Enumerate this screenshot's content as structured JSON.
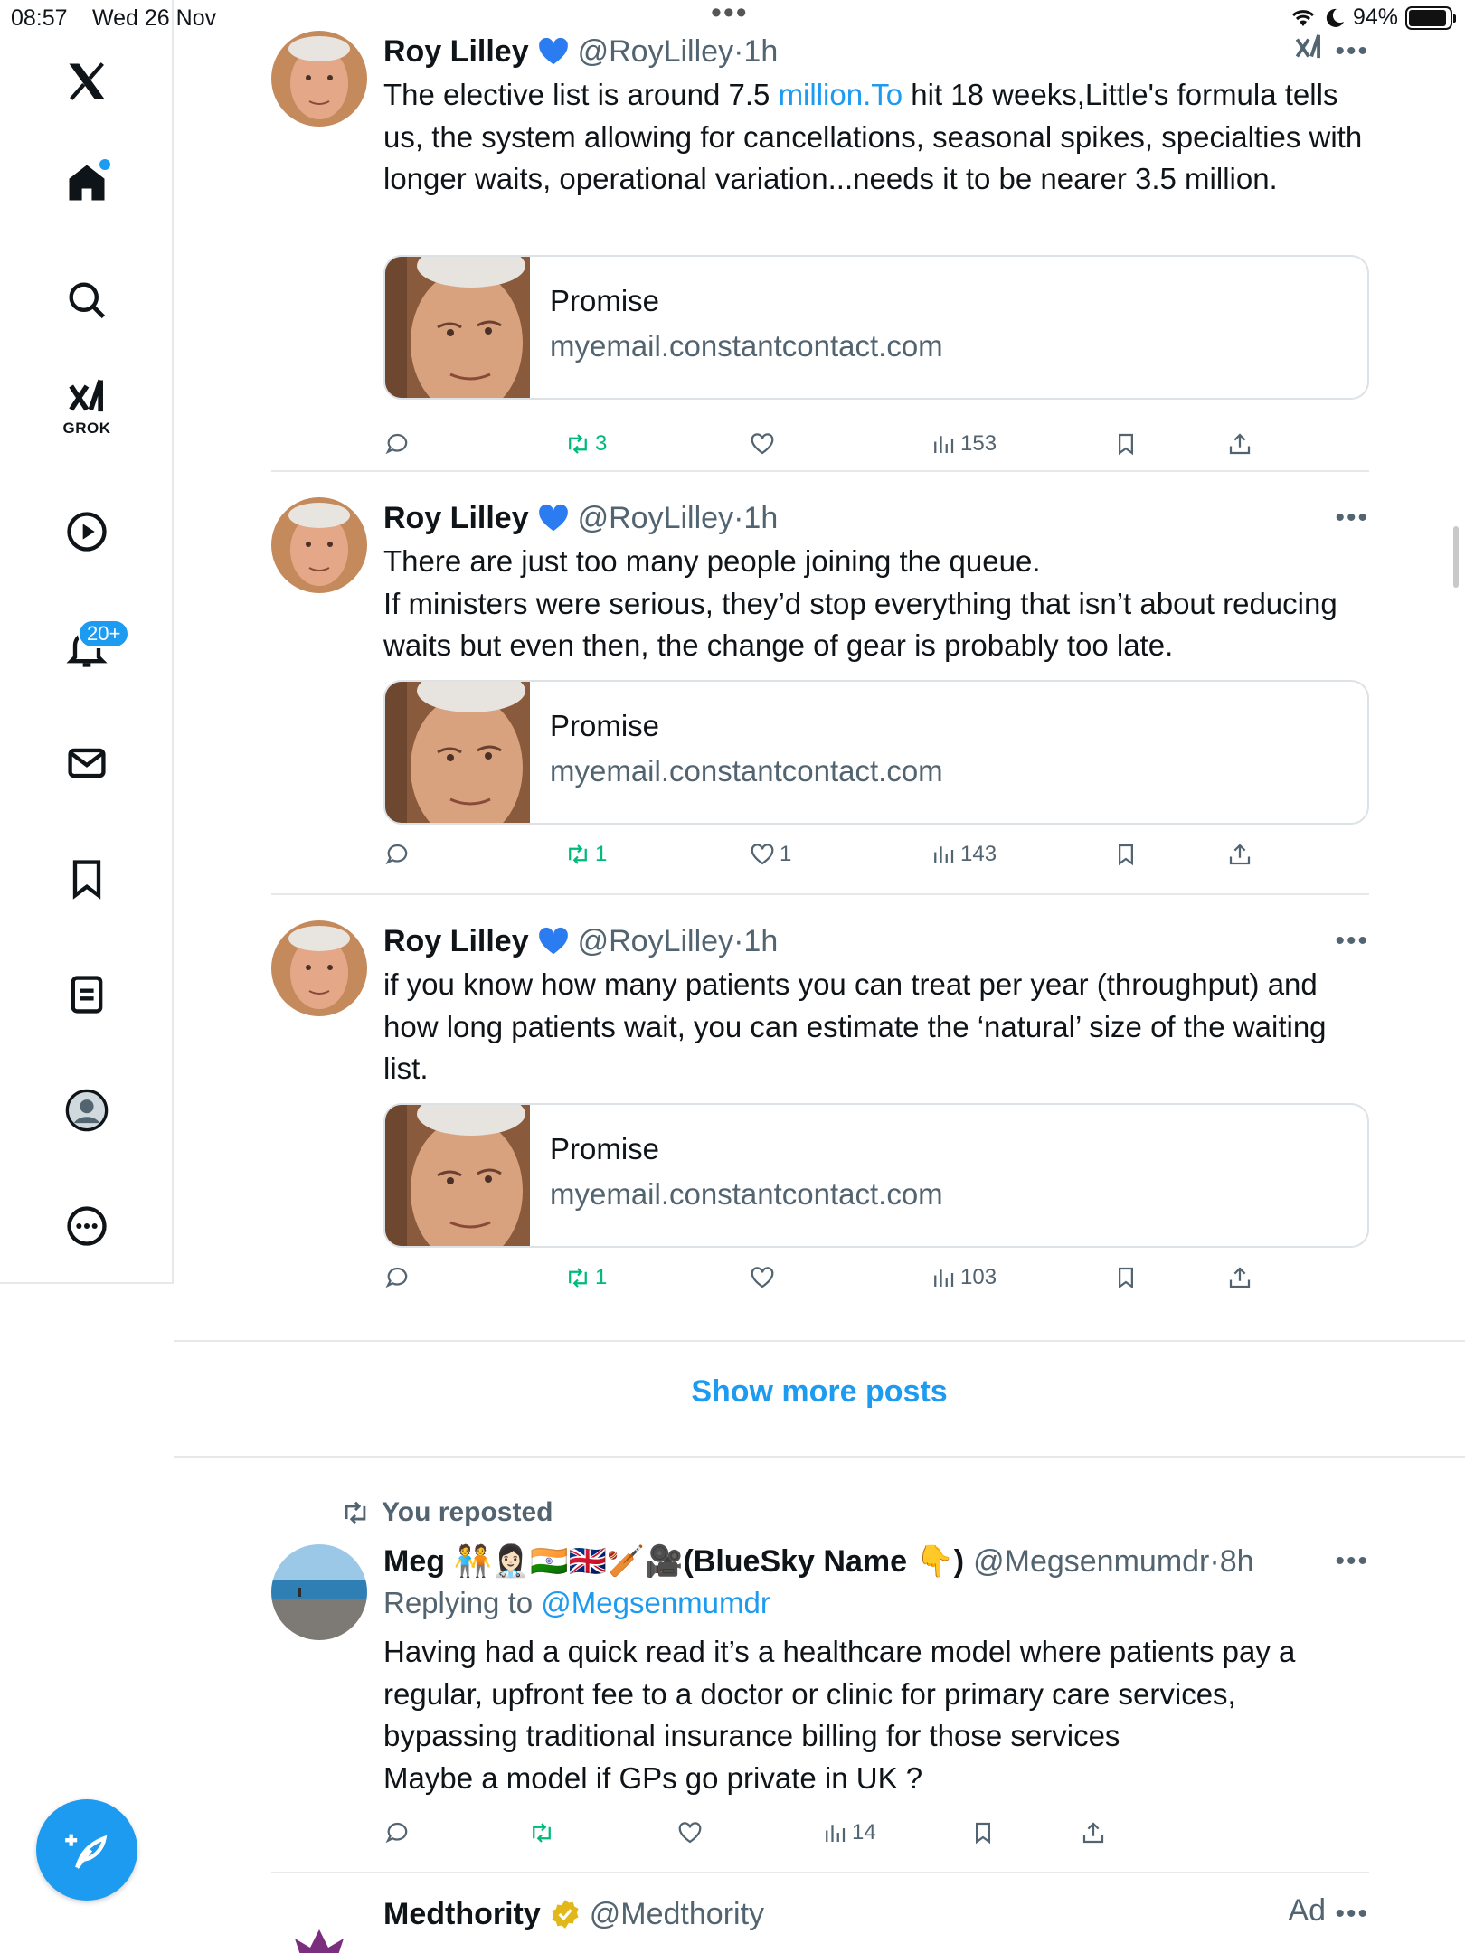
{
  "status_bar": {
    "time": "08:57",
    "date": "Wed 26 Nov",
    "battery": "94%"
  },
  "sidebar": {
    "grok_label": "GROK",
    "notifications_badge": "20+"
  },
  "posts": [
    {
      "author": "Roy Lilley",
      "handle": "@RoyLilley",
      "time": "1h",
      "text_before_link": "The elective list is around 7.5 ",
      "link": "million.To",
      "text_after_link": " hit 18 weeks,Little's formula tells us, the system allowing for cancellations, seasonal spikes, specialties with longer waits, operational variation...needs it to be nearer 3.5 million.",
      "card": {
        "title": "Promise",
        "domain": "myemail.constantcontact.com"
      },
      "reposts": "3",
      "likes": "",
      "views": "153"
    },
    {
      "author": "Roy Lilley",
      "handle": "@RoyLilley",
      "time": "1h",
      "text": "There are just too many people joining the queue.\nIf ministers were serious, they’d stop everything that isn’t about reducing waits but even then, the change of gear is probably too late.",
      "card": {
        "title": "Promise",
        "domain": "myemail.constantcontact.com"
      },
      "reposts": "1",
      "likes": "1",
      "views": "143"
    },
    {
      "author": "Roy Lilley",
      "handle": "@RoyLilley",
      "time": "1h",
      "text": "if you know how many patients you can treat per year (throughput) and how long patients wait, you can estimate the ‘natural’ size of the waiting list.",
      "card": {
        "title": "Promise",
        "domain": "myemail.constantcontact.com"
      },
      "reposts": "1",
      "likes": "",
      "views": "103"
    }
  ],
  "show_more": "Show more posts",
  "repost": {
    "label": "You reposted",
    "author": "Meg 🧑‍🤝‍🧑👩🏻‍⚕️🇮🇳🇬🇧🏏🎥(BlueSky Name 👇)",
    "handle": "@Megsenmumdr",
    "time": "8h",
    "replying_prefix": "Replying to ",
    "replying_handle": "@Megsenmumdr",
    "text": "Having had a quick read it’s a healthcare model where patients pay a regular, upfront fee to a doctor or clinic for primary care services, bypassing traditional insurance billing for those services\nMaybe a model if GPs go private in UK ?",
    "views": "14"
  },
  "ad_post": {
    "author": "Medthority",
    "handle": "@Medthority",
    "label": "Ad"
  },
  "colors": {
    "accent": "#1d9bf0",
    "repost_green": "#00ba7c",
    "muted": "#536471"
  }
}
